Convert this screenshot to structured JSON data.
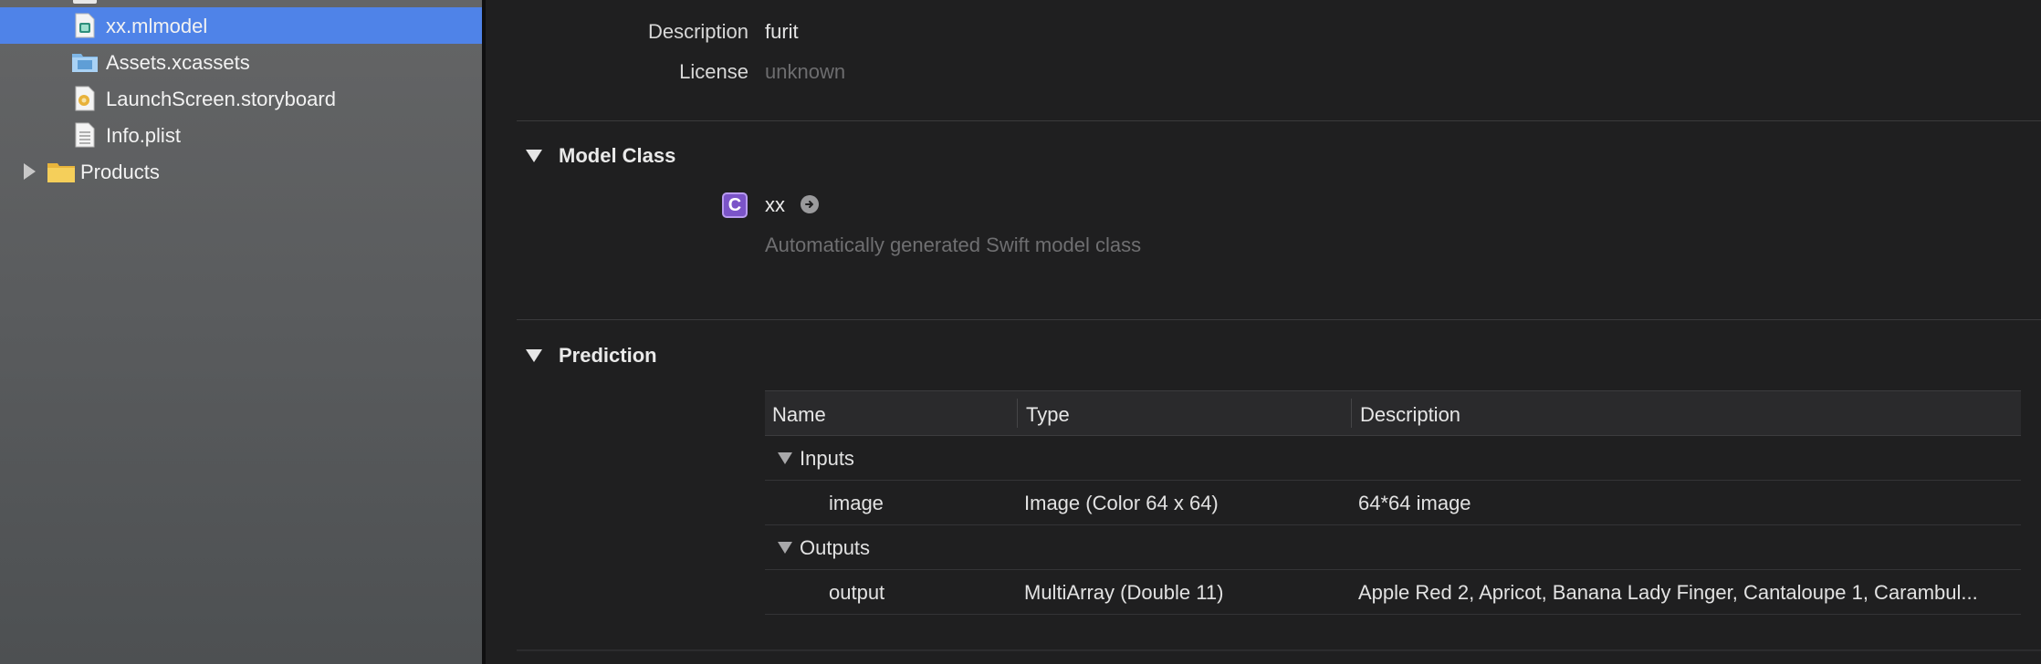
{
  "navigator": {
    "items": [
      {
        "label": "xx.mlmodel",
        "icon": "mlmodel-file-icon",
        "selected": true
      },
      {
        "label": "Assets.xcassets",
        "icon": "asset-catalog-icon",
        "selected": false
      },
      {
        "label": "LaunchScreen.storyboard",
        "icon": "storyboard-file-icon",
        "selected": false
      },
      {
        "label": "Info.plist",
        "icon": "plist-file-icon",
        "selected": false
      },
      {
        "label": "Products",
        "icon": "folder-icon",
        "selected": false,
        "disclosure": "collapsed"
      }
    ]
  },
  "metadata": {
    "description_label": "Description",
    "description_value": "furit",
    "license_label": "License",
    "license_value": "unknown"
  },
  "model_class": {
    "title": "Model Class",
    "badge": "C",
    "class_name": "xx",
    "description": "Automatically generated Swift model class"
  },
  "prediction": {
    "title": "Prediction",
    "columns": [
      "Name",
      "Type",
      "Description"
    ],
    "groups": [
      {
        "label": "Inputs",
        "rows": [
          {
            "name": "image",
            "type": "Image (Color 64 x 64)",
            "description": "64*64 image"
          }
        ]
      },
      {
        "label": "Outputs",
        "rows": [
          {
            "name": "output",
            "type": "MultiArray (Double 11)",
            "description": "Apple Red 2, Apricot, Banana Lady Finger, Cantaloupe 1, Carambul..."
          }
        ]
      }
    ]
  },
  "colors": {
    "selection": "#4f83e8",
    "class_badge": "#7b54c8"
  }
}
